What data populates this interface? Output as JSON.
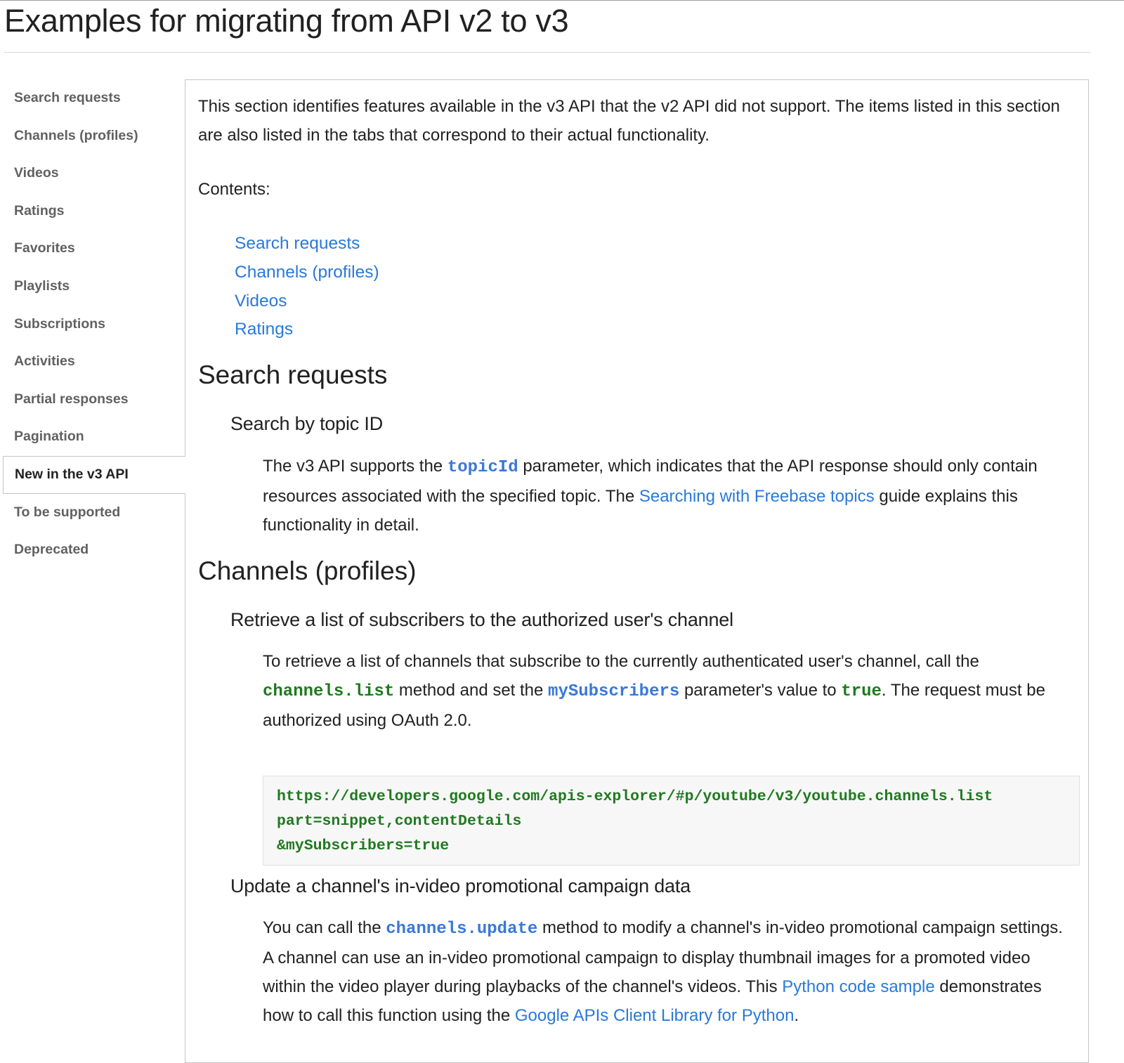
{
  "page": {
    "title": "Examples for migrating from API v2 to v3"
  },
  "sidebar": {
    "items": [
      {
        "label": "Search requests"
      },
      {
        "label": "Channels (profiles)"
      },
      {
        "label": "Videos"
      },
      {
        "label": "Ratings"
      },
      {
        "label": "Favorites"
      },
      {
        "label": "Playlists"
      },
      {
        "label": "Subscriptions"
      },
      {
        "label": "Activities"
      },
      {
        "label": "Partial responses"
      },
      {
        "label": "Pagination"
      },
      {
        "label": "New in the v3 API"
      },
      {
        "label": "To be supported"
      },
      {
        "label": "Deprecated"
      }
    ]
  },
  "content": {
    "intro": "This section identifies features available in the v3 API that the v2 API did not support. The items listed in this section are also listed in the tabs that correspond to their actual functionality.",
    "contents_label": "Contents:",
    "toc": [
      "Search requests",
      "Channels (profiles)",
      "Videos",
      "Ratings"
    ],
    "search": {
      "heading": "Search requests",
      "subheading": "Search by topic ID",
      "p_before": "The v3 API supports the ",
      "code_topic": "topicId",
      "p_mid": " parameter, which indicates that the API response should only contain resources associated with the specified topic. The ",
      "link_guide": "Searching with Freebase topics",
      "p_after": " guide explains this functionality in detail."
    },
    "channels": {
      "heading": "Channels (profiles)",
      "sub1": "Retrieve a list of subscribers to the authorized user's channel",
      "p1_a": "To retrieve a list of channels that subscribe to the currently authenticated user's channel, call the ",
      "code_list": "channels.list",
      "p1_b": " method and set the ",
      "code_mysubs": "mySubscribers",
      "p1_c": " parameter's value to ",
      "code_true": "true",
      "p1_d": ". The request must be authorized using OAuth 2.0.",
      "code_lines": [
        "https://developers.google.com/apis-explorer/#p/youtube/v3/youtube.channels.list",
        "part=snippet,contentDetails",
        "&mySubscribers=true"
      ],
      "sub2": "Update a channel's in-video promotional campaign data",
      "p2_a": "You can call the ",
      "code_update": "channels.update",
      "p2_b": " method to modify a channel's in-video promotional campaign settings. A channel can use an in-video promotional campaign to display thumbnail images for a promoted video within the video player during playbacks of the channel's videos. This ",
      "link_python": "Python code sample",
      "p2_c": " demonstrates how to call this function using the ",
      "link_library": "Google APIs Client Library for Python",
      "p2_d": "."
    }
  },
  "colors": {
    "link": "#2979d9",
    "code_blue": "#3a78d8",
    "code_green": "#1f7a1f",
    "sidebar_text": "#616161"
  }
}
